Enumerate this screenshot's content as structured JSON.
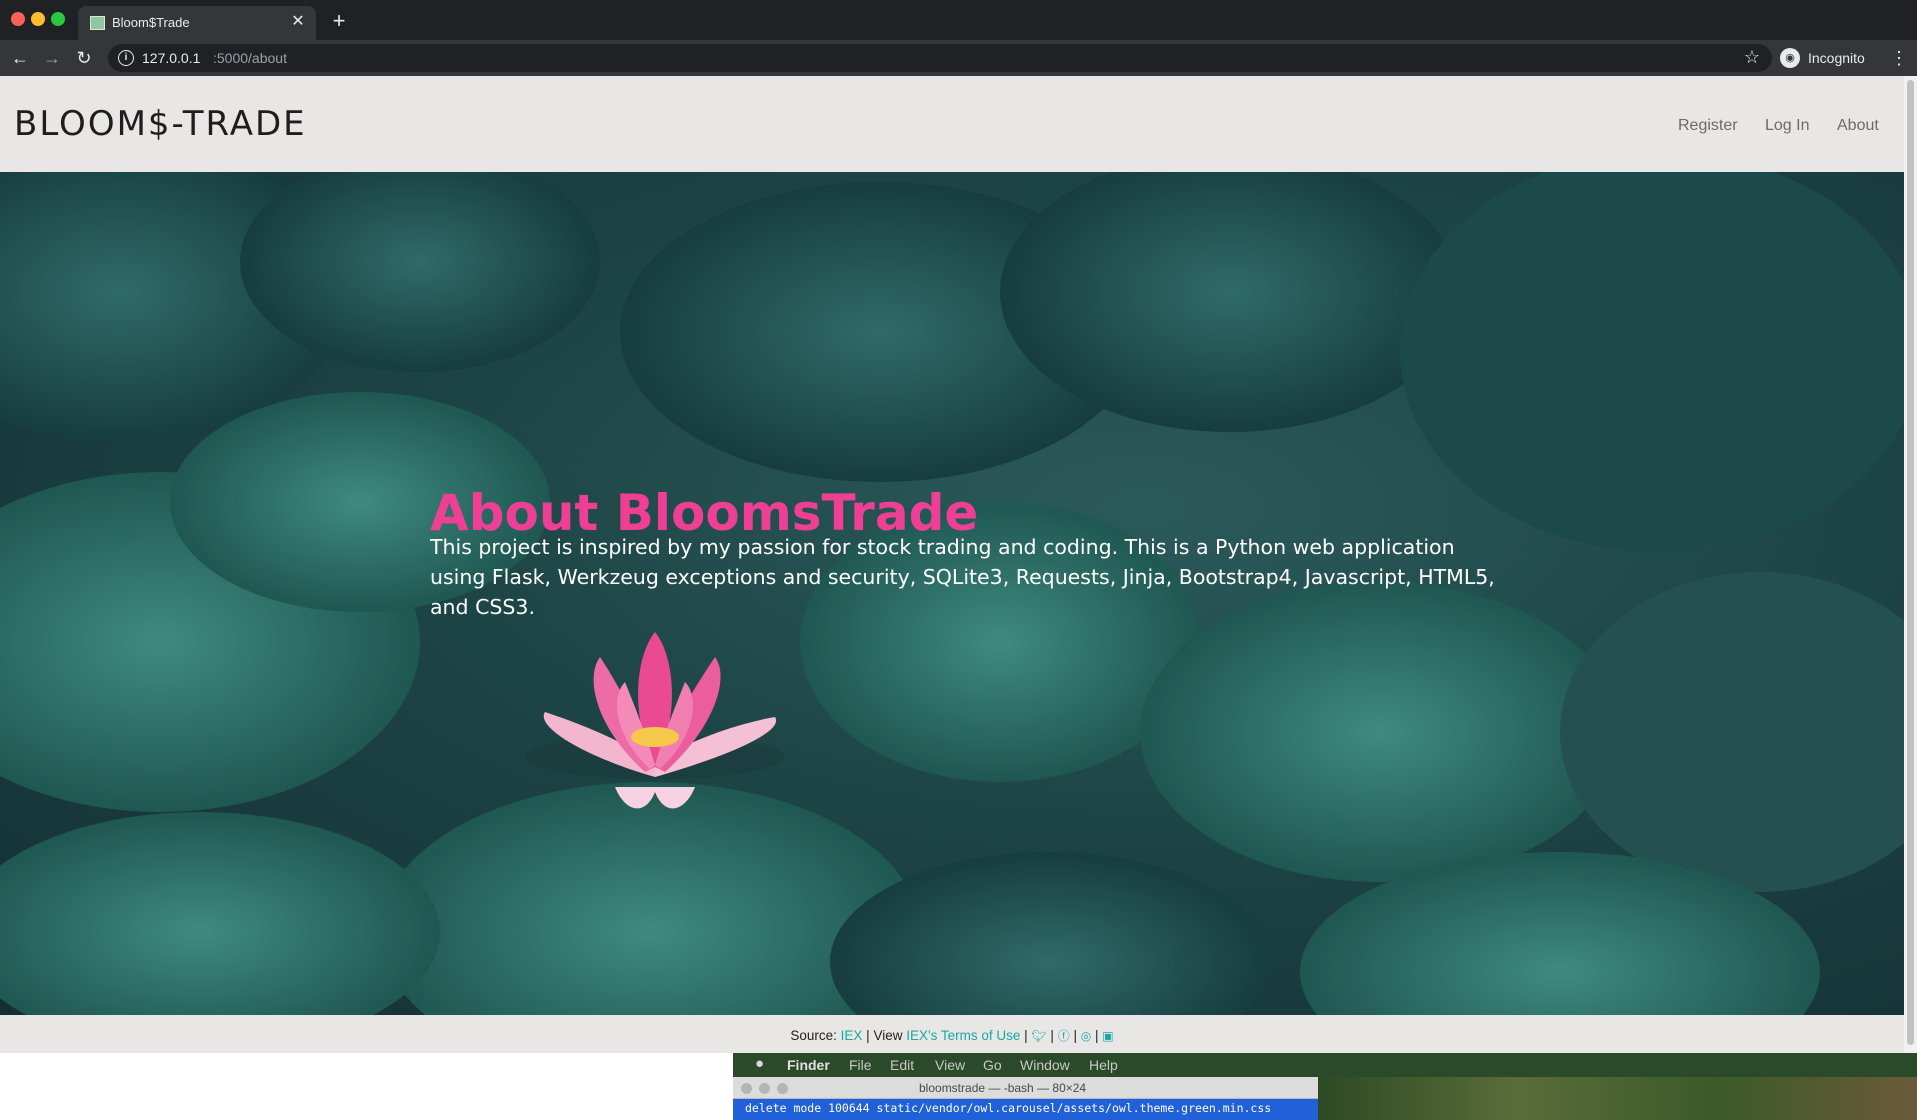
{
  "browser": {
    "tab_title": "Bloom$Trade",
    "url_host": "127.0.0.1",
    "url_path": ":5000/about",
    "profile_label": "Incognito"
  },
  "site": {
    "brand": "BLOOM$-TRADE",
    "nav": {
      "register": "Register",
      "login": "Log In",
      "about": "About"
    },
    "hero": {
      "title": "About BloomsTrade",
      "text": "This project is inspired by my passion for stock trading and coding. This is a Python web application using Flask, Werkzeug exceptions and security, SQLite3, Requests, Jinja, Bootstrap4, Javascript, HTML5, and CSS3."
    },
    "footer": {
      "source_label": "Source:",
      "source_link": "IEX",
      "sep": "|",
      "view_label": "View",
      "terms_link": "IEX's Terms of Use",
      "social_icons": [
        "twitter-icon",
        "facebook-icon",
        "instagram-icon",
        "linkedin-icon"
      ]
    },
    "colors": {
      "accent_pink": "#ee3f95",
      "link_teal": "#1aa7a2",
      "header_bg": "#e9e7e6"
    }
  },
  "desktop": {
    "menu_app": "Finder",
    "menu_items": [
      "File",
      "Edit",
      "View",
      "Go",
      "Window",
      "Help"
    ],
    "terminal_title": "bloomstrade — -bash — 80×24",
    "terminal_line": "delete mode 100644 static/vendor/owl.carousel/assets/owl.theme.green.min.css"
  }
}
